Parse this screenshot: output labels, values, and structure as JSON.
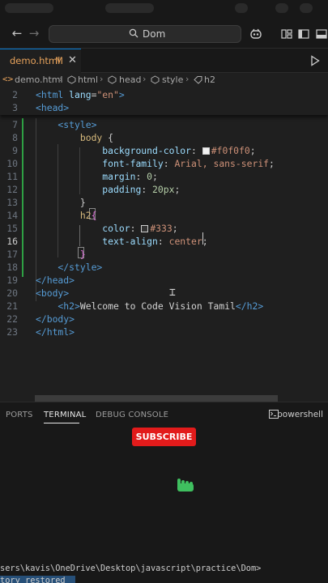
{
  "titlebar": {
    "search_text": "Dom"
  },
  "tab": {
    "label": "demo.html",
    "badge": "M",
    "close": "✕"
  },
  "breadcrumb": [
    "demo.html",
    "html",
    "head",
    "style",
    "h2"
  ],
  "editor": {
    "lines": [
      {
        "n": "2",
        "tokens": [
          [
            "tag",
            "<html "
          ],
          [
            "attr",
            "lang"
          ],
          [
            "punc",
            "="
          ],
          [
            "str",
            "\"en\""
          ],
          [
            "tag",
            ">"
          ]
        ]
      },
      {
        "n": "3",
        "tokens": [
          [
            "tag",
            "<head>"
          ]
        ]
      },
      {
        "n": "7",
        "tokens": [
          [
            "tag",
            "    <style>"
          ]
        ]
      },
      {
        "n": "8",
        "tokens": [
          [
            "sel",
            "        body "
          ],
          [
            "punc",
            "{"
          ]
        ]
      },
      {
        "n": "9",
        "tokens": [
          [
            "prop",
            "            background-color"
          ],
          [
            "punc",
            ": "
          ],
          [
            "swatch",
            "#f0f0f0"
          ],
          [
            "val",
            "#f0f0f0"
          ],
          [
            "punc",
            ";"
          ]
        ]
      },
      {
        "n": "10",
        "tokens": [
          [
            "prop",
            "            font-family"
          ],
          [
            "punc",
            ": "
          ],
          [
            "val",
            "Arial, sans-serif"
          ],
          [
            "punc",
            ";"
          ]
        ]
      },
      {
        "n": "11",
        "tokens": [
          [
            "prop",
            "            margin"
          ],
          [
            "punc",
            ": "
          ],
          [
            "num",
            "0"
          ],
          [
            "punc",
            ";"
          ]
        ]
      },
      {
        "n": "12",
        "tokens": [
          [
            "prop",
            "            padding"
          ],
          [
            "punc",
            ": "
          ],
          [
            "num",
            "20px"
          ],
          [
            "punc",
            ";"
          ]
        ]
      },
      {
        "n": "13",
        "tokens": [
          [
            "punc",
            "        }"
          ]
        ]
      },
      {
        "n": "14",
        "tokens": [
          [
            "sel",
            "        h2"
          ],
          [
            "brace",
            "{"
          ]
        ]
      },
      {
        "n": "15",
        "tokens": [
          [
            "prop",
            "            color"
          ],
          [
            "punc",
            ": "
          ],
          [
            "swatch",
            "#333"
          ],
          [
            "val",
            "#333"
          ],
          [
            "punc",
            ";"
          ]
        ]
      },
      {
        "n": "16",
        "tokens": [
          [
            "prop",
            "            text-align"
          ],
          [
            "punc",
            ": "
          ],
          [
            "val",
            "center"
          ],
          [
            "punc",
            ";"
          ]
        ]
      },
      {
        "n": "17",
        "tokens": [
          [
            "brace",
            "        }"
          ]
        ]
      },
      {
        "n": "18",
        "tokens": [
          [
            "tag",
            "    </style>"
          ]
        ]
      },
      {
        "n": "19",
        "tokens": [
          [
            "tag",
            "</head>"
          ]
        ]
      },
      {
        "n": "20",
        "tokens": [
          [
            "tag",
            "<body>"
          ]
        ]
      },
      {
        "n": "21",
        "tokens": [
          [
            "tag",
            "    <h2>"
          ],
          [
            "txt",
            "Welcome to Code Vision Tamil"
          ],
          [
            "tag",
            "</h2>"
          ]
        ]
      },
      {
        "n": "22",
        "tokens": [
          [
            "tag",
            "</body>"
          ]
        ]
      },
      {
        "n": "23",
        "tokens": [
          [
            "tag",
            "</html>"
          ]
        ]
      }
    ],
    "active_line": "16"
  },
  "panel": {
    "tabs": [
      "PORTS",
      "TERMINAL",
      "DEBUG CONSOLE"
    ],
    "active_tab": "TERMINAL",
    "shell": "powershell",
    "subscribe_label": "SUBSCRIBE",
    "terminal_path": "sers\\kavis\\OneDrive\\Desktop\\javascript\\practice\\Dom>",
    "terminal_restored": "tory restored"
  },
  "colors": {
    "accent": "#0078d4",
    "subscribe": "#e21b1b",
    "modified": "#e8a35c"
  }
}
